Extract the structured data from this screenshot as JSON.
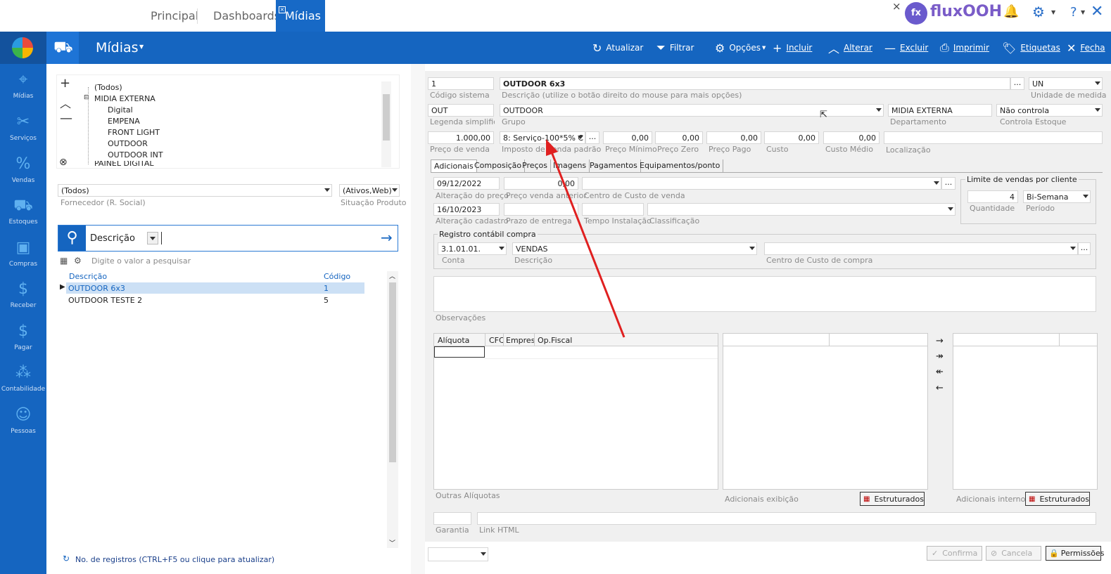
{
  "tabs": [
    {
      "label": "Principal"
    },
    {
      "label": "Dashboards"
    },
    {
      "label": "Mídias"
    }
  ],
  "brand": "fluxOOH",
  "help_label": "?",
  "module_title": "Mídias",
  "toolbar": {
    "atualizar": "Atualizar",
    "filtrar": "Filtrar",
    "opcoes": "Opções",
    "incluir": "Incluir",
    "alterar": "Alterar",
    "excluir": "Excluir",
    "imprimir": "Imprimir",
    "etiquetas": "Etiquetas",
    "fechar": "Fecha"
  },
  "sidebar": {
    "items": [
      {
        "label": "Mídias",
        "icon": "location-icon"
      },
      {
        "label": "Serviços",
        "icon": "tools-icon"
      },
      {
        "label": "Vendas",
        "icon": "percent-icon"
      },
      {
        "label": "Estoques",
        "icon": "cart-icon"
      },
      {
        "label": "Compras",
        "icon": "box-icon"
      },
      {
        "label": "Receber",
        "icon": "coin-icon"
      },
      {
        "label": "Pagar",
        "icon": "coin-hand-icon"
      },
      {
        "label": "Contabilidade",
        "icon": "ledger-icon"
      },
      {
        "label": "Pessoas",
        "icon": "person-icon"
      }
    ]
  },
  "tree": {
    "items": [
      "(Todos)",
      "MIDIA EXTERNA",
      "Digital",
      "EMPENA",
      "FRONT LIGHT",
      "OUTDOOR",
      "OUTDOOR INT",
      "PAINEL DIGITAL"
    ]
  },
  "filters": {
    "fornecedor_value": "(Todos)",
    "fornecedor_label": "Fornecedor (R. Social)",
    "situacao_value": "(Ativos,Web)",
    "situacao_label": "Situação Produto"
  },
  "search": {
    "field": "Descrição",
    "hint": "Digite o valor a pesquisar"
  },
  "list": {
    "headers": [
      "Descrição",
      "Código"
    ],
    "rows": [
      {
        "descricao": "OUTDOOR 6x3",
        "codigo": "1"
      },
      {
        "descricao": "OUTDOOR TESTE 2",
        "codigo": "5"
      }
    ]
  },
  "footer": {
    "registros": "No. de registros (CTRL+F5 ou clique para atualizar)"
  },
  "form": {
    "codigo": "1",
    "codigo_label": "Código sistema",
    "descricao": "OUTDOOR 6x3",
    "descricao_label": "Descrição (utilize o botão direito do mouse para mais opções)",
    "unidade": "UN",
    "unidade_label": "Unidade de medida",
    "legenda": "OUT",
    "legenda_label": "Legenda simplificada",
    "grupo": "OUTDOOR",
    "grupo_label": "Grupo",
    "departamento": "MIDIA EXTERNA",
    "departamento_label": "Departamento",
    "estoque": "Não controla",
    "estoque_label": "Controla Estoque",
    "preco_venda": "1.000,00",
    "preco_venda_label": "Preço de venda",
    "imposto": "8: Serviço-100*5% C",
    "imposto_label": "Imposto de venda padrão",
    "preco_minimo": "0,00",
    "preco_minimo_label": "Preço Mínimo",
    "preco_zero": "0,00",
    "preco_zero_label": "Preço Zero",
    "preco_pago": "0,00",
    "preco_pago_label": "Preço Pago",
    "custo": "0,00",
    "custo_label": "Custo",
    "custo_medio": "0,00",
    "custo_medio_label": "Custo Médio",
    "localizacao_label": "Localização",
    "ellipsis": "..."
  },
  "subtabs": [
    "Adicionais",
    "Composição",
    "Preços",
    "Imagens",
    "Pagamentos",
    "Equipamentos/ponto"
  ],
  "adicionais": {
    "alteracao_preco": "09/12/2022",
    "alteracao_preco_label": "Alteração do preço",
    "preco_anterior": "0,00",
    "preco_anterior_label": "Preço venda anterior",
    "centro_custo_venda_label": "Centro de Custo de venda",
    "alteracao_cadastro": "16/10/2023",
    "alteracao_cadastro_label": "Alteração cadastro",
    "prazo_label": "Prazo de entrega",
    "tempo_label": "Tempo Instalação",
    "classificacao_label": "Classificação",
    "limite_title": "Limite de vendas por cliente",
    "quantidade": "4",
    "quantidade_label": "Quantidade",
    "periodo": "Bi-Semana",
    "periodo_label": "Período",
    "registro_title": "Registro contábil compra",
    "conta": "3.1.01.01.",
    "conta_label": "Conta",
    "conta_desc": "VENDAS",
    "conta_desc_label": "Descrição",
    "centro_compra_label": "Centro de Custo de compra",
    "observacoes_label": "Observações",
    "aliq_headers": [
      "Alíquota",
      "CFC",
      "Empresa",
      "Op.Fiscal"
    ],
    "outras_label": "Outras Alíquotas",
    "adicionais_exibicao_label": "Adicionais exibição",
    "adicionais_internos_label": "Adicionais internos",
    "estruturados": "Estruturados",
    "garantia_label": "Garantia",
    "link_label": "Link HTML"
  },
  "buttons": {
    "confirma": "Confirma",
    "cancela": "Cancela",
    "permissoes": "Permissões"
  },
  "colors": {
    "brand_blue": "#1565c0",
    "arrow_red": "#e02020",
    "selection": "#cce0f5"
  }
}
